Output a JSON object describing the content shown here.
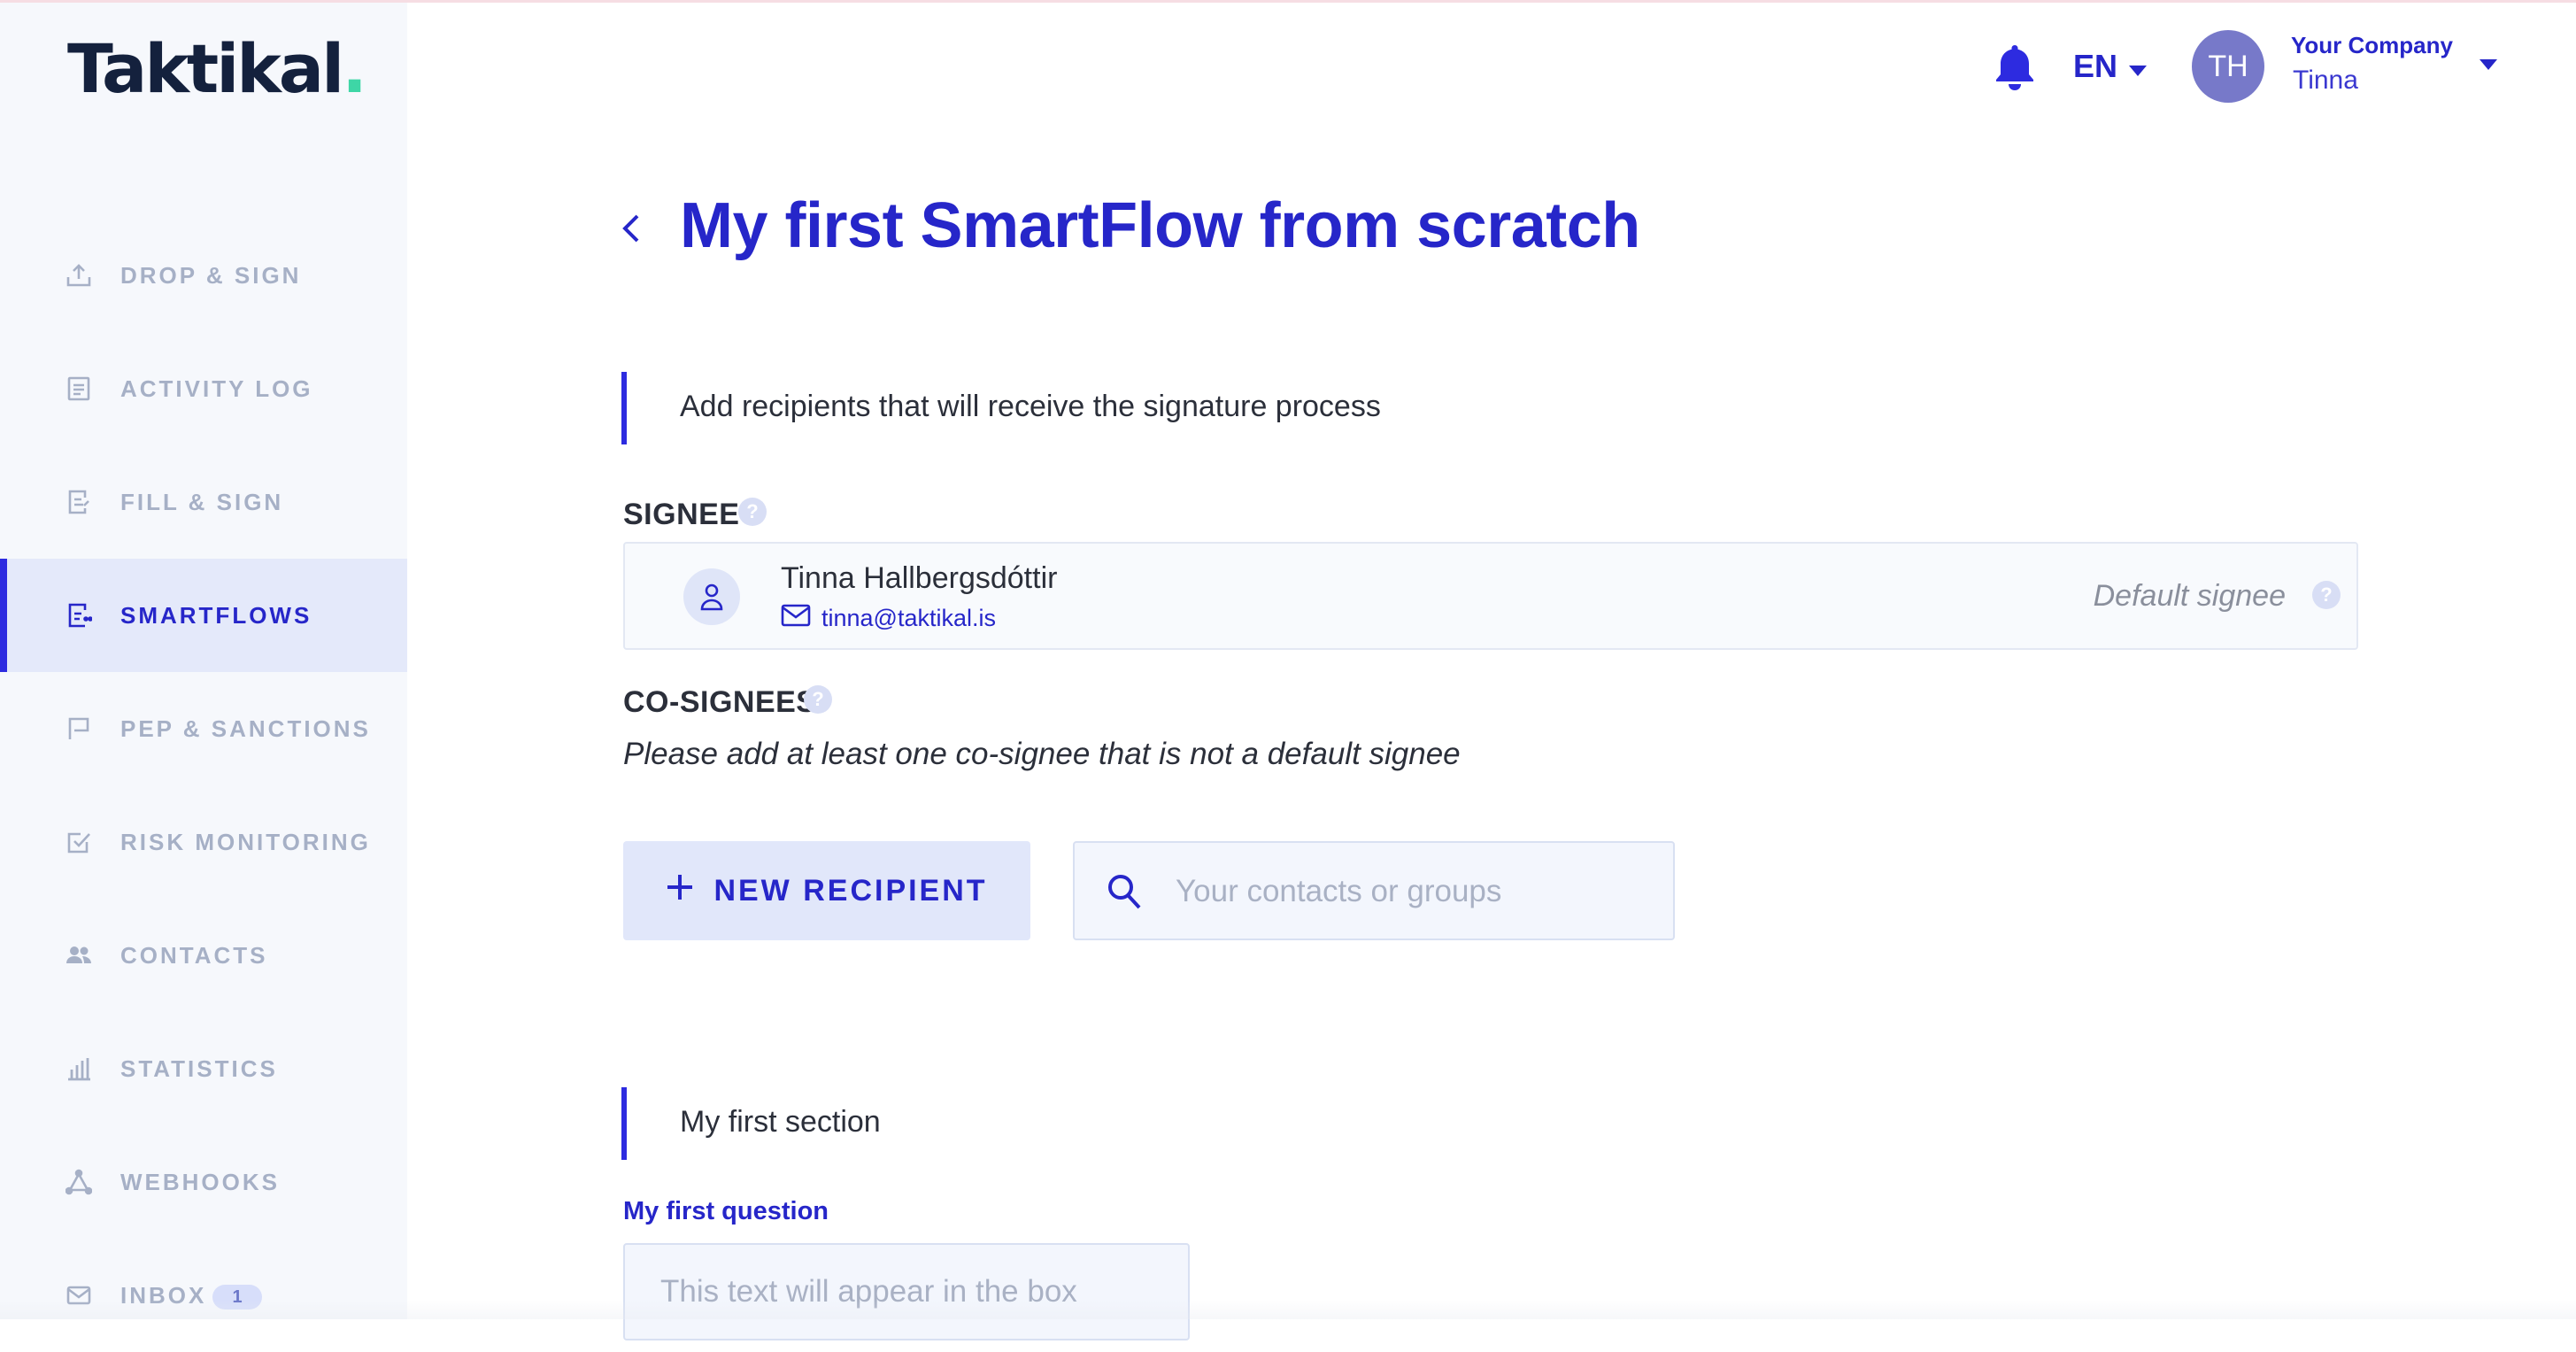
{
  "app": {
    "logo_text": "Taktikal",
    "logo_dot": "."
  },
  "sidebar": {
    "items": [
      {
        "label": "DROP & SIGN",
        "icon": "upload-icon",
        "active": false
      },
      {
        "label": "ACTIVITY LOG",
        "icon": "log-icon",
        "active": false
      },
      {
        "label": "FILL & SIGN",
        "icon": "fill-sign-icon",
        "active": false
      },
      {
        "label": "SMARTFLOWS",
        "icon": "smartflow-icon",
        "active": true
      },
      {
        "label": "PEP & SANCTIONS",
        "icon": "flag-icon",
        "active": false
      },
      {
        "label": "RISK MONITORING",
        "icon": "checkbox-icon",
        "active": false
      },
      {
        "label": "CONTACTS",
        "icon": "people-icon",
        "active": false
      },
      {
        "label": "STATISTICS",
        "icon": "bar-chart-icon",
        "active": false
      },
      {
        "label": "WEBHOOKS",
        "icon": "webhook-icon",
        "active": false
      },
      {
        "label": "INBOX",
        "icon": "mail-icon",
        "active": false,
        "badge": "1"
      }
    ]
  },
  "header": {
    "language": "EN",
    "avatar_initials": "TH",
    "company": "Your Company",
    "user_name": "Tinna"
  },
  "main": {
    "title": "My first SmartFlow from scratch",
    "intro_section": "Add recipients that will receive the signature process",
    "signee_label": "SIGNEE",
    "signee": {
      "name": "Tinna Hallbergsdóttir",
      "email": "tinna@taktikal.is",
      "role": "Default signee"
    },
    "cosignees_label": "CO-SIGNEES",
    "cosignees_hint": "Please add at least one co-signee that is not a default signee",
    "new_recipient_label": "NEW RECIPIENT",
    "search_placeholder": "Your contacts or groups",
    "section2_title": "My first section",
    "question_label": "My first question",
    "question_placeholder": "This text will appear in the box"
  },
  "colors": {
    "accent": "#2626c9",
    "sidebar_bg": "#f6f8fc",
    "active_bg": "#e4e9fa",
    "muted_nav": "#a6b0c6",
    "logo_dot": "#3ed6a6"
  }
}
